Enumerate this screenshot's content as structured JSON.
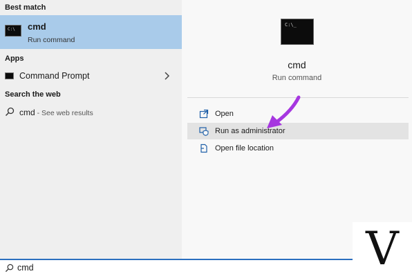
{
  "left": {
    "best_match_title": "Best match",
    "best_match": {
      "name": "cmd",
      "subtitle": "Run command",
      "icon": "terminal-icon"
    },
    "apps_title": "Apps",
    "apps": [
      {
        "label": "Command Prompt",
        "icon": "terminal-icon",
        "chevron": "chevron-right-icon"
      }
    ],
    "web_title": "Search the web",
    "web": {
      "query": "cmd",
      "hint": " - See web results",
      "icon": "search-icon"
    }
  },
  "right": {
    "title": "cmd",
    "subtitle": "Run command",
    "actions": [
      {
        "label": "Open",
        "icon": "open-icon"
      },
      {
        "label": "Run as administrator",
        "icon": "admin-shield-icon"
      },
      {
        "label": "Open file location",
        "icon": "file-location-icon"
      }
    ]
  },
  "search": {
    "value": "cmd",
    "icon": "search-icon"
  },
  "watermark": {
    "glyph": "V"
  },
  "colors": {
    "selected": "#a9cbea",
    "accent": "#2b6fbf",
    "arrow": "#a637e0"
  }
}
